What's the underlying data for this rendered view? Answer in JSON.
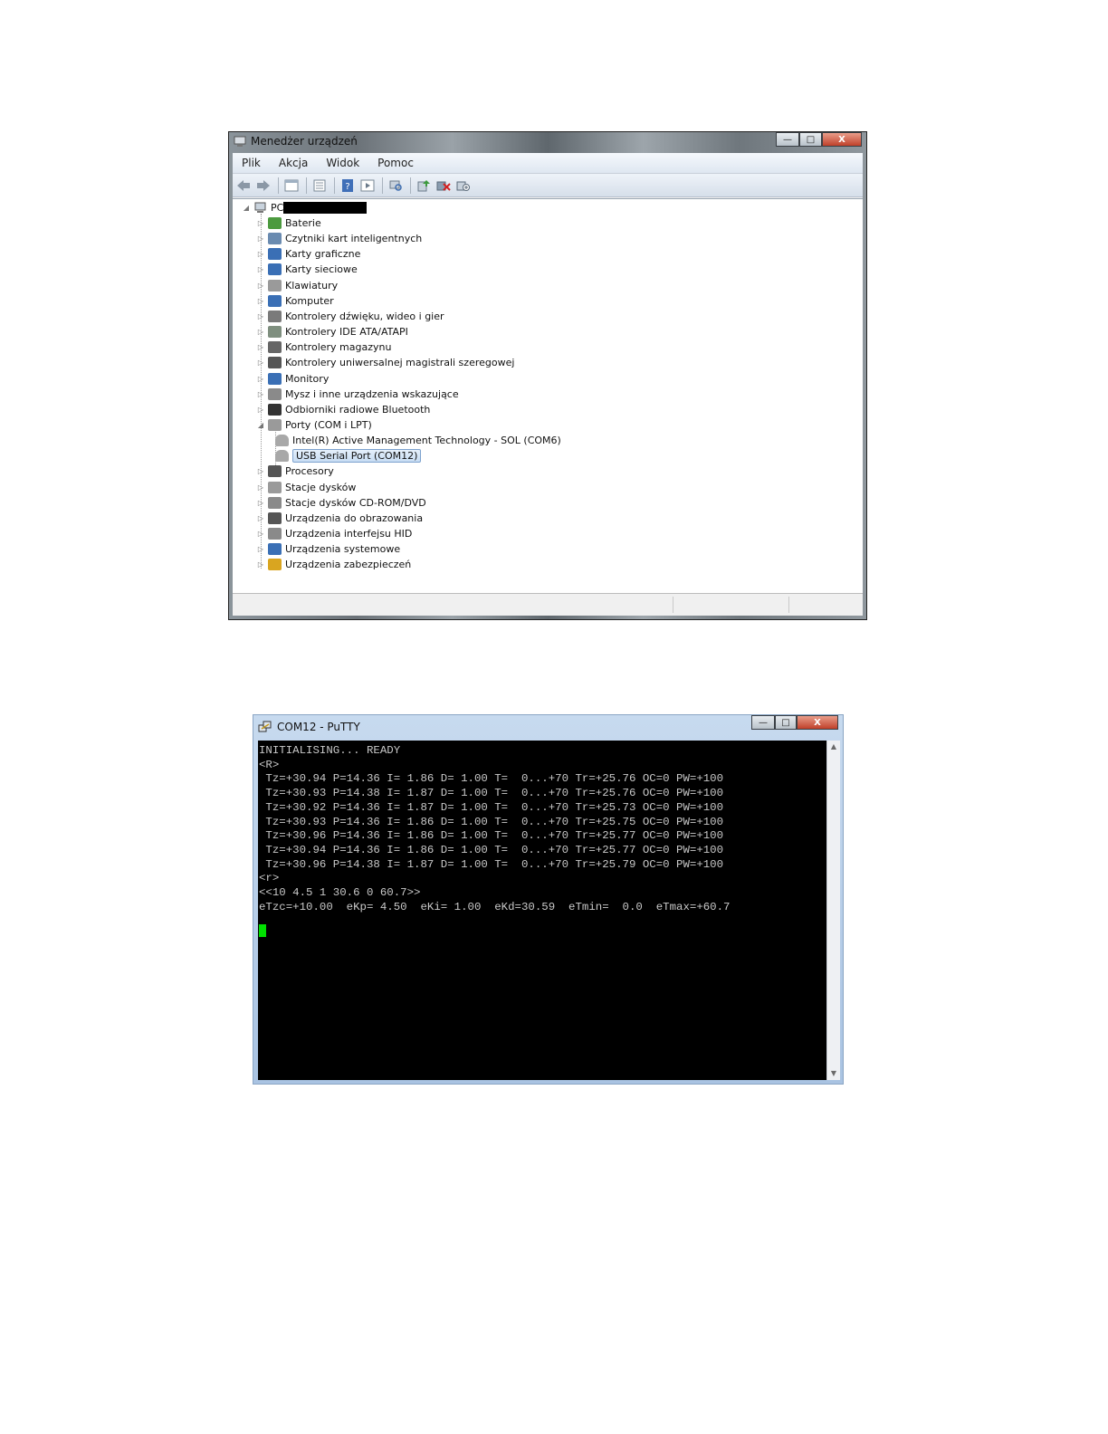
{
  "device_manager": {
    "title": "Menedżer urządzeń",
    "window_buttons": {
      "minimize": "—",
      "maximize": "□",
      "close": "X"
    },
    "menu": [
      "Plik",
      "Akcja",
      "Widok",
      "Pomoc"
    ],
    "toolbar_icons": [
      "back-arrow-icon",
      "forward-arrow-icon",
      "tree-view-icon",
      "properties-icon",
      "help-icon",
      "run-icon",
      "scan-hardware-icon",
      "update-driver-icon",
      "uninstall-icon",
      "enable-device-icon"
    ],
    "root": "PC",
    "categories": [
      {
        "label": "Baterie",
        "icon": "battery-icon",
        "color": "#4c9a3f"
      },
      {
        "label": "Czytniki kart inteligentnych",
        "icon": "smartcard-reader-icon",
        "color": "#6a8bb0"
      },
      {
        "label": "Karty graficzne",
        "icon": "display-adapter-icon",
        "color": "#3a6fb5"
      },
      {
        "label": "Karty sieciowe",
        "icon": "network-adapter-icon",
        "color": "#3a6fb5"
      },
      {
        "label": "Klawiatury",
        "icon": "keyboard-icon",
        "color": "#9a9a9a"
      },
      {
        "label": "Komputer",
        "icon": "computer-icon",
        "color": "#3a6fb5"
      },
      {
        "label": "Kontrolery dźwięku, wideo i gier",
        "icon": "speaker-icon",
        "color": "#7a7a7a"
      },
      {
        "label": "Kontrolery IDE ATA/ATAPI",
        "icon": "ide-controller-icon",
        "color": "#7f8f7f"
      },
      {
        "label": "Kontrolery magazynu",
        "icon": "storage-controller-icon",
        "color": "#666666"
      },
      {
        "label": "Kontrolery uniwersalnej magistrali szeregowej",
        "icon": "usb-icon",
        "color": "#555555"
      },
      {
        "label": "Monitory",
        "icon": "monitor-icon",
        "color": "#3a6fb5"
      },
      {
        "label": "Mysz i inne urządzenia wskazujące",
        "icon": "mouse-icon",
        "color": "#8a8a8a"
      },
      {
        "label": "Odbiorniki radiowe Bluetooth",
        "icon": "bluetooth-icon",
        "color": "#333333"
      },
      {
        "label": "Porty (COM i LPT)",
        "icon": "port-icon",
        "color": "#9a9a9a"
      }
    ],
    "port_children": [
      {
        "label": "Intel(R) Active Management Technology - SOL (COM6)",
        "icon": "port-icon"
      },
      {
        "label": "USB Serial Port (COM12)",
        "icon": "port-icon",
        "selected": true
      }
    ],
    "categories_after": [
      {
        "label": "Procesory",
        "icon": "processor-icon",
        "color": "#555555"
      },
      {
        "label": "Stacje dysków",
        "icon": "floppy-drive-icon",
        "color": "#9a9a9a"
      },
      {
        "label": "Stacje dysków CD-ROM/DVD",
        "icon": "cdrom-drive-icon",
        "color": "#8a8a8a"
      },
      {
        "label": "Urządzenia do obrazowania",
        "icon": "imaging-device-icon",
        "color": "#555555"
      },
      {
        "label": "Urządzenia interfejsu HID",
        "icon": "hid-device-icon",
        "color": "#8a8a8a"
      },
      {
        "label": "Urządzenia systemowe",
        "icon": "system-device-icon",
        "color": "#3a6fb5"
      },
      {
        "label": "Urządzenia zabezpieczeń",
        "icon": "security-key-icon",
        "color": "#d9a520"
      }
    ]
  },
  "putty": {
    "title": "COM12 - PuTTY",
    "window_buttons": {
      "minimize": "—",
      "maximize": "□",
      "close": "X"
    },
    "lines": [
      "INITIALISING... READY",
      "<R>",
      " Tz=+30.94 P=14.36 I= 1.86 D= 1.00 T=  0...+70 Tr=+25.76 OC=0 PW=+100",
      " Tz=+30.93 P=14.38 I= 1.87 D= 1.00 T=  0...+70 Tr=+25.76 OC=0 PW=+100",
      " Tz=+30.92 P=14.36 I= 1.87 D= 1.00 T=  0...+70 Tr=+25.73 OC=0 PW=+100",
      " Tz=+30.93 P=14.36 I= 1.86 D= 1.00 T=  0...+70 Tr=+25.75 OC=0 PW=+100",
      " Tz=+30.96 P=14.36 I= 1.86 D= 1.00 T=  0...+70 Tr=+25.77 OC=0 PW=+100",
      " Tz=+30.94 P=14.36 I= 1.86 D= 1.00 T=  0...+70 Tr=+25.77 OC=0 PW=+100",
      " Tz=+30.96 P=14.38 I= 1.87 D= 1.00 T=  0...+70 Tr=+25.79 OC=0 PW=+100",
      "<r>",
      "<<10 4.5 1 30.6 0 60.7>>",
      "eTzc=+10.00  eKp= 4.50  eKi= 1.00  eKd=30.59  eTmin=  0.0  eTmax=+60.7"
    ],
    "cursor_color": "#00e000",
    "scroll_up": "▲",
    "scroll_down": "▼"
  }
}
